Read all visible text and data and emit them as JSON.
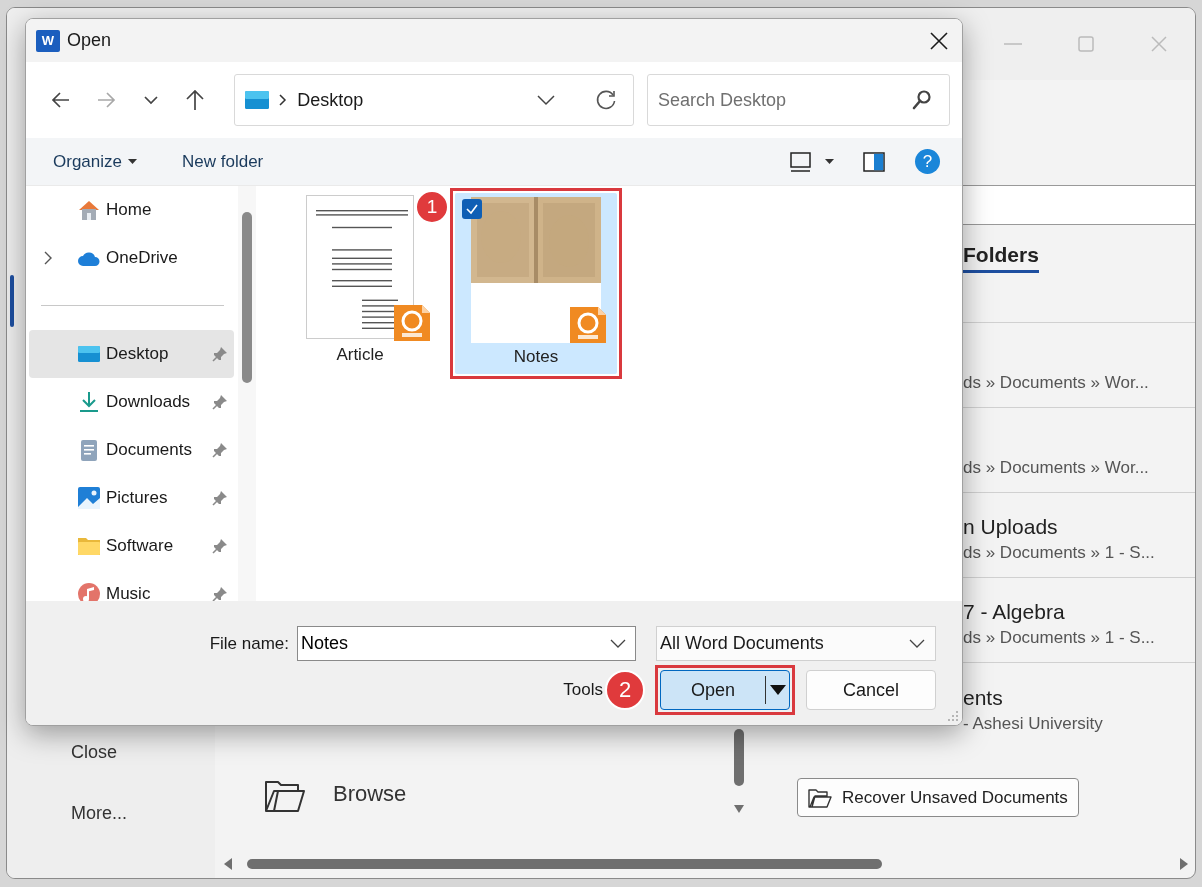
{
  "background_window": {
    "nav_items": [
      {
        "label": "Close"
      },
      {
        "label": "More..."
      }
    ],
    "places": [
      {
        "kind": "folder",
        "label": "Browse"
      }
    ],
    "tabs": [
      {
        "label": "Folders",
        "selected": true
      }
    ],
    "folders": [
      {
        "kind": "cut",
        "subtitle": "ds » Documents » Wor..."
      },
      {
        "kind": "cut",
        "subtitle": "ds » Documents » Wor..."
      },
      {
        "kind": "cut",
        "title": "n Uploads",
        "subtitle": "ds » Documents » 1 - S..."
      },
      {
        "kind": "cut",
        "title": "7 - Algebra",
        "subtitle": "ds » Documents » 1 - S..."
      },
      {
        "kind": "cut",
        "title": "ents",
        "subtitle": "- Ashesi University"
      }
    ],
    "recover_button": {
      "label": "Recover Unsaved Documents"
    }
  },
  "dialog": {
    "app_icon": "W",
    "title": "Open",
    "nav_buttons": [
      {
        "kind": "back",
        "disabled": false
      },
      {
        "kind": "forward",
        "disabled": true
      },
      {
        "kind": "recent",
        "disabled": false
      },
      {
        "kind": "up",
        "disabled": false
      }
    ],
    "address": {
      "location": "Desktop"
    },
    "search": {
      "placeholder": "Search Desktop"
    },
    "toolbar": {
      "buttons": [
        {
          "kind": "menu",
          "label": "Organize"
        },
        {
          "kind": "plain",
          "label": "New folder"
        }
      ],
      "help": "?"
    },
    "sidebar": {
      "sections": [
        {
          "items": [
            {
              "kind": "home",
              "label": "Home",
              "expandable": false,
              "pinned": false,
              "selected": false
            },
            {
              "kind": "cloud",
              "label": "OneDrive",
              "expandable": true,
              "pinned": false,
              "selected": false
            }
          ]
        },
        {
          "items": [
            {
              "kind": "desktop",
              "label": "Desktop",
              "expandable": false,
              "pinned": true,
              "selected": true
            },
            {
              "kind": "download",
              "label": "Downloads",
              "expandable": false,
              "pinned": true,
              "selected": false
            },
            {
              "kind": "documents",
              "label": "Documents",
              "expandable": false,
              "pinned": true,
              "selected": false
            },
            {
              "kind": "pictures",
              "label": "Pictures",
              "expandable": false,
              "pinned": true,
              "selected": false
            },
            {
              "kind": "folder",
              "label": "Software",
              "expandable": false,
              "pinned": true,
              "selected": false
            },
            {
              "kind": "music",
              "label": "Music",
              "expandable": false,
              "pinned": true,
              "selected": false
            }
          ]
        }
      ]
    },
    "files": [
      {
        "kind": "document",
        "name": "Article",
        "selected": false,
        "highlighted": false
      },
      {
        "kind": "scan",
        "name": "Notes",
        "selected": true,
        "highlighted": true
      }
    ],
    "file_name": {
      "label": "File name:",
      "value": "Notes"
    },
    "file_type": {
      "value": "All Word Documents"
    },
    "tools": "Tools",
    "open_button": {
      "label": "Open",
      "highlighted": true
    },
    "cancel_button": {
      "label": "Cancel"
    },
    "annotations": [
      "1",
      "2"
    ]
  }
}
